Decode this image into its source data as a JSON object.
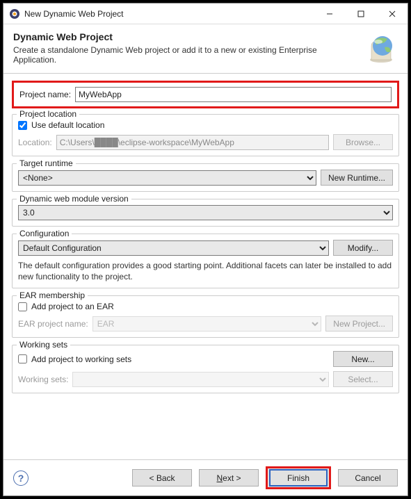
{
  "window": {
    "title": "New Dynamic Web Project"
  },
  "header": {
    "title": "Dynamic Web Project",
    "subtitle": "Create a standalone Dynamic Web project or add it to a new or existing Enterprise Application."
  },
  "projectName": {
    "label": "Project name:",
    "value": "MyWebApp"
  },
  "location": {
    "legend": "Project location",
    "useDefault": "Use default location",
    "locationLabel": "Location:",
    "locationValue": "C:\\Users\\████\\eclipse-workspace\\MyWebApp",
    "browse": "Browse..."
  },
  "runtime": {
    "legend": "Target runtime",
    "selected": "<None>",
    "newRuntime": "New Runtime..."
  },
  "module": {
    "legend": "Dynamic web module version",
    "selected": "3.0"
  },
  "config": {
    "legend": "Configuration",
    "selected": "Default Configuration",
    "modify": "Modify...",
    "desc": "The default configuration provides a good starting point. Additional facets can later be installed to add new functionality to the project."
  },
  "ear": {
    "legend": "EAR membership",
    "add": "Add project to an EAR",
    "nameLabel": "EAR project name:",
    "nameValue": "EAR",
    "newProject": "New Project..."
  },
  "ws": {
    "legend": "Working sets",
    "add": "Add project to working sets",
    "new": "New...",
    "label": "Working sets:",
    "select": "Select..."
  },
  "buttons": {
    "back": "< Back",
    "next": "Next >",
    "finish": "Finish",
    "cancel": "Cancel"
  }
}
